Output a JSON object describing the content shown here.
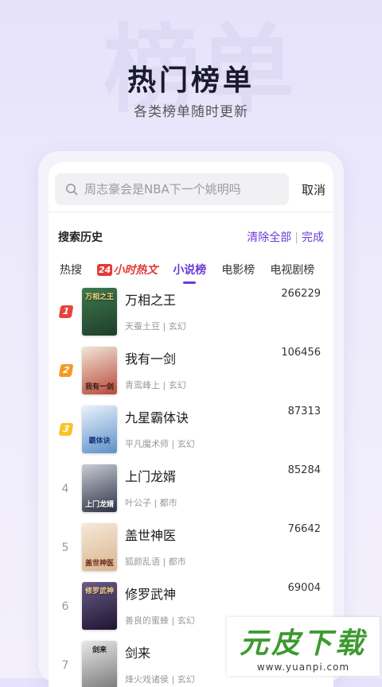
{
  "hero": {
    "title": "热门榜单",
    "subtitle": "各类榜单随时更新",
    "bg_decoration": "榜单"
  },
  "search": {
    "placeholder": "周志豪会是NBA下一个姚明吗",
    "cancel_label": "取消"
  },
  "history": {
    "title": "搜索历史",
    "clear_label": "清除全部",
    "separator": "|",
    "done_label": "完成"
  },
  "tabs": [
    {
      "label": "热搜",
      "active": false
    },
    {
      "label_num": "24",
      "label": "小时热文",
      "active": false
    },
    {
      "label": "小说榜",
      "active": true
    },
    {
      "label": "电影榜",
      "active": false
    },
    {
      "label": "电视剧榜",
      "active": false
    }
  ],
  "books": [
    {
      "rank": "1",
      "title": "万相之王",
      "meta": "天蚕土豆 | 玄幻",
      "count": "266229",
      "cover_text": "万相之王",
      "cover_color": "#2e5a3a",
      "badge_color": "#e8433a"
    },
    {
      "rank": "2",
      "title": "我有一剑",
      "meta": "青鸾峰上 | 玄幻",
      "count": "106456",
      "cover_text": "我有一剑",
      "cover_color": "#b8473a",
      "badge_color": "#f39a25"
    },
    {
      "rank": "3",
      "title": "九星霸体诀",
      "meta": "平凡魔术师 | 玄幻",
      "count": "87313",
      "cover_text": "霸体诀",
      "cover_color": "#5d8fc9",
      "badge_color": "#f7c328"
    },
    {
      "rank": "4",
      "title": "上门龙婿",
      "meta": "叶公子 | 都市",
      "count": "85284",
      "cover_text": "上门龙婿",
      "cover_color": "#2c3246"
    },
    {
      "rank": "5",
      "title": "盖世神医",
      "meta": "狐颜乱语 | 都市",
      "count": "76642",
      "cover_text": "盖世神医",
      "cover_color": "#d9b48f"
    },
    {
      "rank": "6",
      "title": "修罗武神",
      "meta": "善良的蜜蜂 | 玄幻",
      "count": "69004",
      "cover_text": "修罗武神",
      "cover_color": "#3b2b50"
    },
    {
      "rank": "7",
      "title": "剑来",
      "meta": "烽火戏诸侯 | 玄幻",
      "count": "",
      "cover_text": "剑来",
      "cover_color": "#7a7a7a"
    }
  ],
  "watermark": {
    "logo": "元皮下载",
    "url": "www.yuanpi.com"
  },
  "colors": {
    "accent": "#6b3ad8",
    "hot_red": "#e33a3a"
  }
}
